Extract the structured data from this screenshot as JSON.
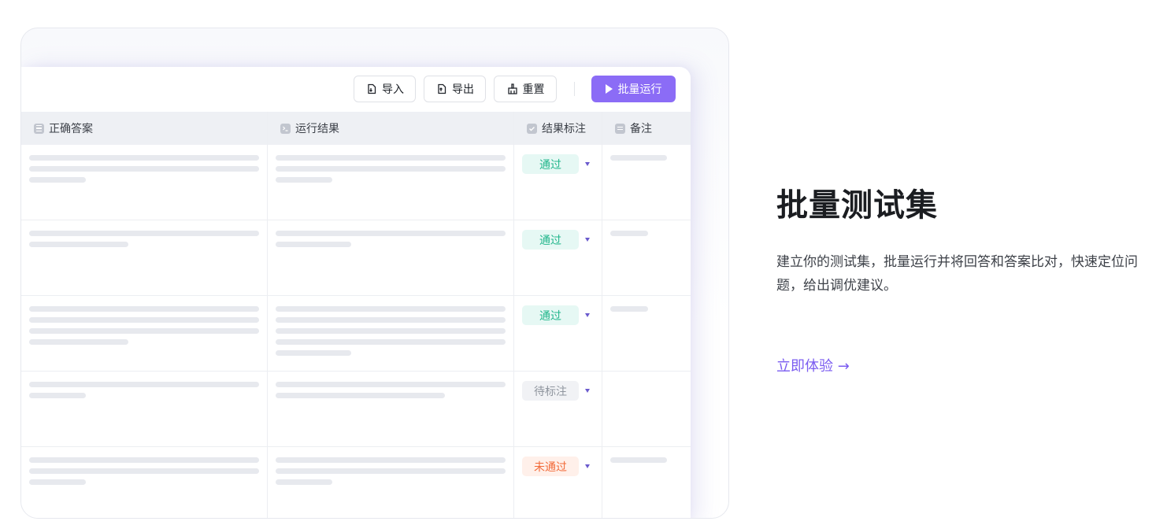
{
  "toolbar": {
    "import_label": "导入",
    "export_label": "导出",
    "reset_label": "重置",
    "run_label": "批量运行"
  },
  "table": {
    "columns": [
      "正确答案",
      "运行结果",
      "结果标注",
      "备注"
    ],
    "rows": [
      {
        "status": "通过",
        "status_type": "pass"
      },
      {
        "status": "通过",
        "status_type": "pass"
      },
      {
        "status": "通过",
        "status_type": "pass"
      },
      {
        "status": "待标注",
        "status_type": "pending"
      },
      {
        "status": "未通过",
        "status_type": "fail"
      }
    ]
  },
  "feature": {
    "title": "批量测试集",
    "description": "建立你的测试集，批量运行并将回答和答案比对，快速定位问题，给出调优建议。",
    "cta": "立即体验 →"
  },
  "colors": {
    "accent": "#8b6cf6",
    "pass": "#21b68b",
    "fail": "#f26b3a",
    "pending": "#8f959e"
  }
}
